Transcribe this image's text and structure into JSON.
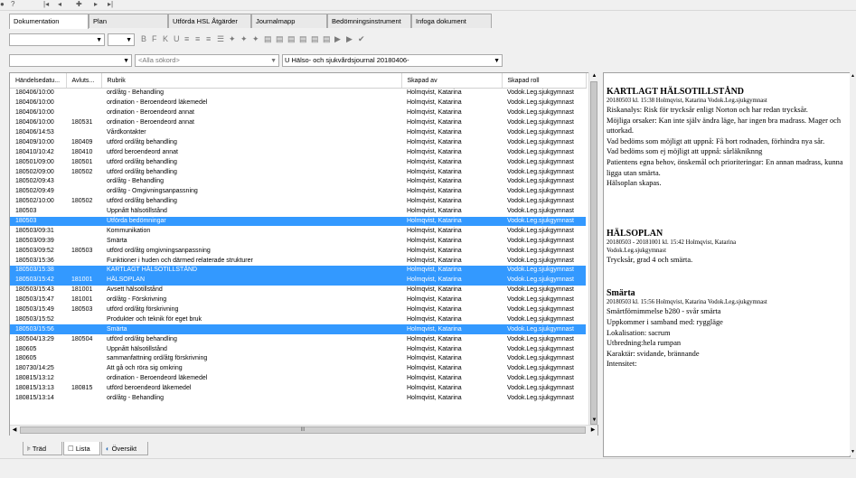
{
  "topnav": {
    "icons": [
      "refresh-icon",
      "help-icon",
      "first-icon",
      "prev-icon",
      "plus-icon",
      "next-icon",
      "last-icon"
    ],
    "glyphs": [
      "●",
      "?",
      "|◂",
      "◂",
      "✚",
      "▸",
      "▸|"
    ]
  },
  "tabs": [
    {
      "label": "Dokumentation",
      "active": true
    },
    {
      "label": "Plan",
      "active": false
    },
    {
      "label": "Utförda HSL Åtgärder",
      "active": false
    },
    {
      "label": "Journalmapp",
      "active": false
    },
    {
      "label": "Bedömningsinstrument",
      "active": false
    },
    {
      "label": "Infoga dokument",
      "active": false
    }
  ],
  "toolbar": {
    "font_value": "",
    "size_value": "",
    "icons": [
      "B",
      "F",
      "K",
      "U",
      "≡",
      "≡",
      "≡",
      "☰",
      "✦",
      "✦",
      "✦",
      "▤",
      "▤",
      "▤",
      "▤",
      "▤",
      "▤",
      "▶",
      "▶",
      "✔"
    ]
  },
  "filter": {
    "first_value": "",
    "search_placeholder": "<Alla sökord>",
    "journal_value": "U Hälso- och sjukvårdsjournal 20180406-"
  },
  "list": {
    "columns": [
      "Händelsedatu...",
      "Avluts...",
      "Rubrik",
      "Skapad av",
      "Skapad roll"
    ],
    "rows": [
      [
        "180406/10:00",
        "",
        "ord/åtg - Behandling",
        "Holmqvist, Katarina",
        "Vodok.Leg.sjukgymnast",
        false
      ],
      [
        "180406/10:00",
        "",
        "ordination - Beroendeord läkemedel",
        "Holmqvist, Katarina",
        "Vodok.Leg.sjukgymnast",
        false
      ],
      [
        "180406/10:00",
        "",
        "ordination - Beroendeord annat",
        "Holmqvist, Katarina",
        "Vodok.Leg.sjukgymnast",
        false
      ],
      [
        "180406/10:00",
        "180531",
        "ordination - Beroendeord annat",
        "Holmqvist, Katarina",
        "Vodok.Leg.sjukgymnast",
        false
      ],
      [
        "180406/14:53",
        "",
        "Vårdkontakter",
        "Holmqvist, Katarina",
        "Vodok.Leg.sjukgymnast",
        false
      ],
      [
        "180409/10:00",
        "180409",
        "utförd ord/åtg behandling",
        "Holmqvist, Katarina",
        "Vodok.Leg.sjukgymnast",
        false
      ],
      [
        "180410/10:42",
        "180410",
        "utförd beroendeord annat",
        "Holmqvist, Katarina",
        "Vodok.Leg.sjukgymnast",
        false
      ],
      [
        "180501/09:00",
        "180501",
        "utförd ord/åtg behandling",
        "Holmqvist, Katarina",
        "Vodok.Leg.sjukgymnast",
        false
      ],
      [
        "180502/09:00",
        "180502",
        "utförd ord/åtg behandling",
        "Holmqvist, Katarina",
        "Vodok.Leg.sjukgymnast",
        false
      ],
      [
        "180502/09:43",
        "",
        "ord/åtg - Behandling",
        "Holmqvist, Katarina",
        "Vodok.Leg.sjukgymnast",
        false
      ],
      [
        "180502/09:49",
        "",
        "ord/åtg - Omgivningsanpassning",
        "Holmqvist, Katarina",
        "Vodok.Leg.sjukgymnast",
        false
      ],
      [
        "180502/10:00",
        "180502",
        "utförd ord/åtg behandling",
        "Holmqvist, Katarina",
        "Vodok.Leg.sjukgymnast",
        false
      ],
      [
        "180503",
        "",
        "Uppnått hälsotillstånd",
        "Holmqvist, Katarina",
        "Vodok.Leg.sjukgymnast",
        false
      ],
      [
        "180503",
        "",
        "Utförda bedömningar",
        "Holmqvist, Katarina",
        "Vodok.Leg.sjukgymnast",
        true
      ],
      [
        "180503/09:31",
        "",
        "Kommunikation",
        "Holmqvist, Katarina",
        "Vodok.Leg.sjukgymnast",
        false
      ],
      [
        "180503/09:39",
        "",
        "Smärta",
        "Holmqvist, Katarina",
        "Vodok.Leg.sjukgymnast",
        false
      ],
      [
        "180503/09:52",
        "180503",
        "utförd ord/åtg omgivningsanpassning",
        "Holmqvist, Katarina",
        "Vodok.Leg.sjukgymnast",
        false
      ],
      [
        "180503/15:36",
        "",
        "Funktioner i huden och därmed relaterade strukturer",
        "Holmqvist, Katarina",
        "Vodok.Leg.sjukgymnast",
        false
      ],
      [
        "180503/15:38",
        "",
        "KARTLAGT HÄLSOTILLSTÅND",
        "Holmqvist, Katarina",
        "Vodok.Leg.sjukgymnast",
        true
      ],
      [
        "180503/15:42",
        "181001",
        "HÄLSOPLAN",
        "Holmqvist, Katarina",
        "Vodok.Leg.sjukgymnast",
        true
      ],
      [
        "180503/15:43",
        "181001",
        "Avsett hälsotillstånd",
        "Holmqvist, Katarina",
        "Vodok.Leg.sjukgymnast",
        false
      ],
      [
        "180503/15:47",
        "181001",
        "ord/åtg - Förskrivning",
        "Holmqvist, Katarina",
        "Vodok.Leg.sjukgymnast",
        false
      ],
      [
        "180503/15:49",
        "180503",
        "utförd ord/åtg förskrivning",
        "Holmqvist, Katarina",
        "Vodok.Leg.sjukgymnast",
        false
      ],
      [
        "180503/15:52",
        "",
        "Produkter och teknik för eget bruk",
        "Holmqvist, Katarina",
        "Vodok.Leg.sjukgymnast",
        false
      ],
      [
        "180503/15:56",
        "",
        "Smärta",
        "Holmqvist, Katarina",
        "Vodok.Leg.sjukgymnast",
        true
      ],
      [
        "180504/13:29",
        "180504",
        "utförd ord/åtg behandling",
        "Holmqvist, Katarina",
        "Vodok.Leg.sjukgymnast",
        false
      ],
      [
        "180605",
        "",
        "Uppnått hälsotillstånd",
        "Holmqvist, Katarina",
        "Vodok.Leg.sjukgymnast",
        false
      ],
      [
        "180605",
        "",
        "sammanfattning ord/åtg förskrivning",
        "Holmqvist, Katarina",
        "Vodok.Leg.sjukgymnast",
        false
      ],
      [
        "180730/14:25",
        "",
        "Att gå och röra sig omkring",
        "Holmqvist, Katarina",
        "Vodok.Leg.sjukgymnast",
        false
      ],
      [
        "180815/13:12",
        "",
        "ordination - Beroendeord läkemedel",
        "Holmqvist, Katarina",
        "Vodok.Leg.sjukgymnast",
        false
      ],
      [
        "180815/13:13",
        "180815",
        "utförd beroendeord läkemedel",
        "Holmqvist, Katarina",
        "Vodok.Leg.sjukgymnast",
        false
      ],
      [
        "180815/13:14",
        "",
        "ord/åtg - Behandling",
        "Holmqvist, Katarina",
        "Vodok.Leg.sjukgymnast",
        false
      ]
    ],
    "hscroll_grip": "III"
  },
  "bottom_tabs": [
    {
      "label": "Träd",
      "icon": "tree-icon",
      "active": false
    },
    {
      "label": "Lista",
      "icon": "list-icon",
      "active": true
    },
    {
      "label": "Översikt",
      "icon": "overview-icon",
      "active": false
    }
  ],
  "doc": {
    "sections": [
      {
        "heading": "KARTLAGT HÄLSOTILLSTÅND",
        "meta": [
          "20180503 kl. 15:38  Holmqvist, Katarina  Vodok.Leg.sjukgymnast"
        ],
        "lines": [
          "Riskanalys: Risk för trycksår enligt Norton och har redan trycksår.",
          "Möjliga orsaker: Kan inte själv ändra läge, har ingen bra madrass. Mager och uttorkad.",
          "Vad bedöms som möjligt att uppnå: Få bort rodnaden, förhindra nya sår.",
          "Vad bedöms som ej möjligt att uppnå: sårläkniknng",
          "Patientens egna behov, önskemål och prioriteringar: En annan madrass, kunna ligga utan smärta.",
          "Hälsoplan skapas."
        ]
      },
      {
        "heading": "HÄLSOPLAN",
        "meta": [
          "20180503 - 20181001 kl. 15:42  Holmqvist, Katarina",
          "Vodok.Leg.sjukgymnast"
        ],
        "lines": [
          "Trycksår, grad 4 och smärta."
        ]
      },
      {
        "heading": "Smärta",
        "meta": [
          "20180503 kl. 15:56  Holmqvist, Katarina  Vodok.Leg.sjukgymnast"
        ],
        "lines": [
          "Smärtförnimmelse b280  - svår smärta",
          "Uppkommer i samband med: ryggläge",
          "Lokalisation: sacrum",
          "Utbredning:hela rumpan",
          "Karaktär: svidande, brännande",
          "Intensitet:"
        ]
      }
    ]
  },
  "colors": {
    "selection": "#3399ff"
  }
}
